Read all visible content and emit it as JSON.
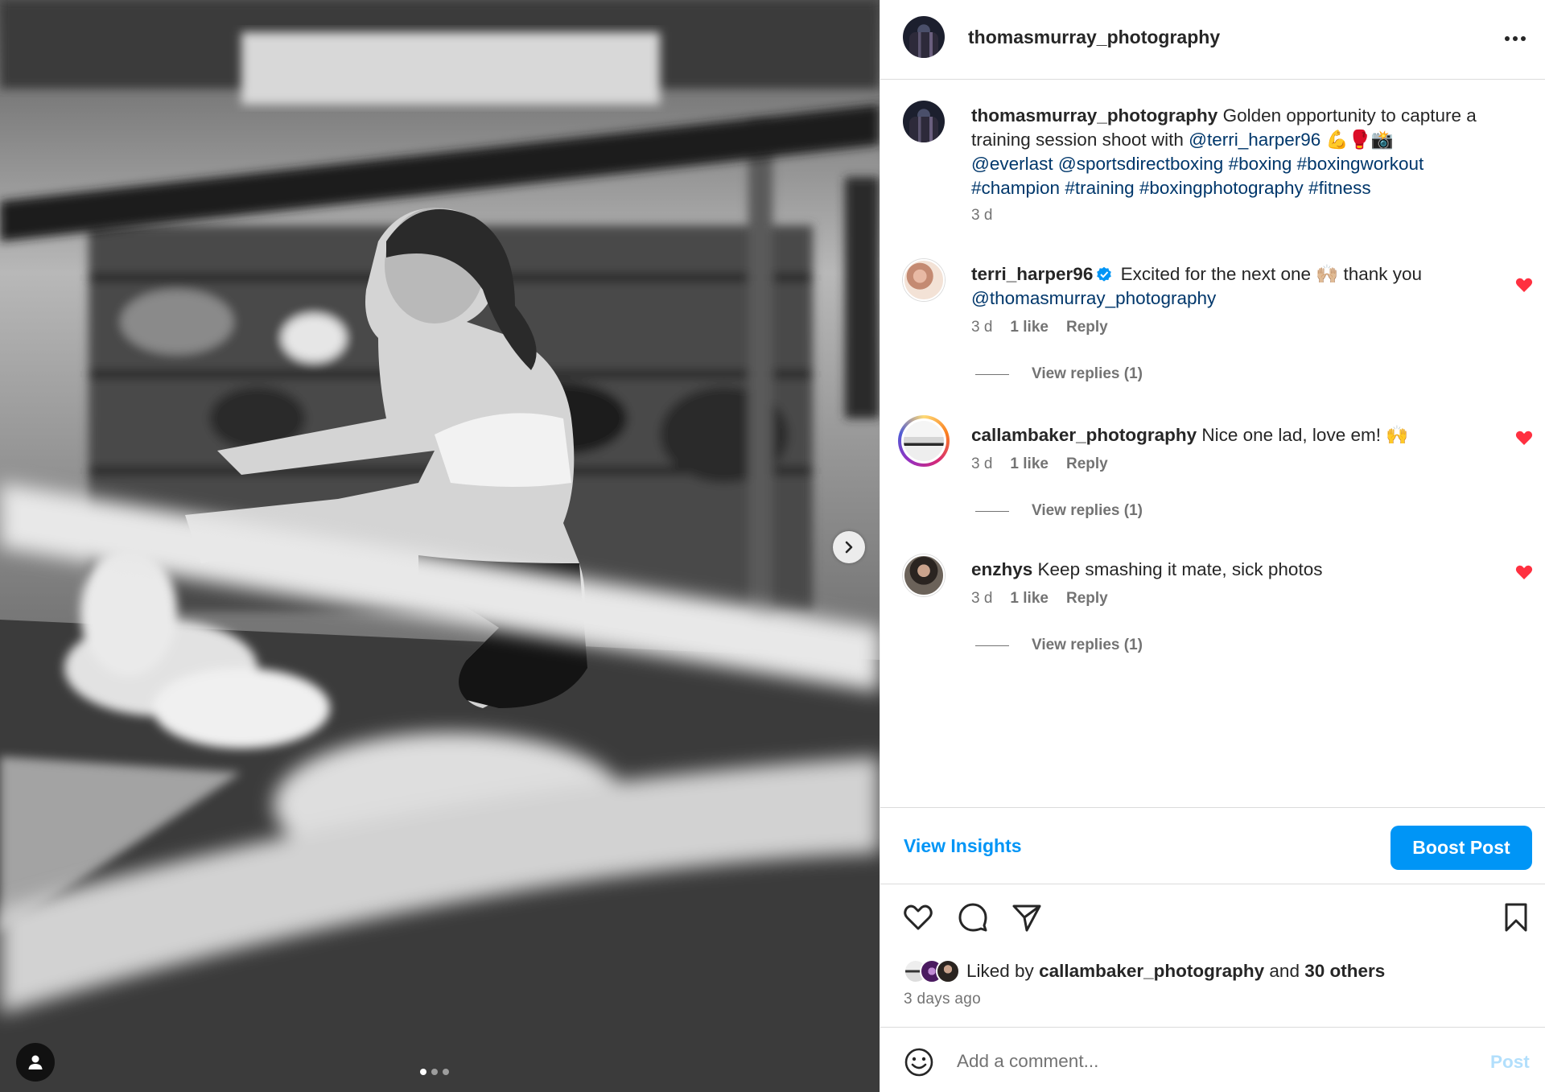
{
  "post": {
    "author": "thomasmurray_photography",
    "caption": {
      "username": "thomasmurray_photography",
      "text_1": " Golden opportunity to capture a training session shoot with ",
      "mention_1": "@terri_harper96",
      "emojis": " 💪🥊📸",
      "mention_2": "@everlast",
      "mention_3": "@sportsdirectboxing",
      "hashtags_1": "#boxing #boxingworkout",
      "hashtags_2": "#champion #training #boxingphotography #fitness",
      "time": "3 d"
    },
    "carousel": {
      "slides": 3,
      "active": 1
    }
  },
  "comments": [
    {
      "username": "terri_harper96",
      "verified": true,
      "text": " Excited for the next one 🙌🏼 thank you ",
      "mention": "@thomasmurray_photography",
      "time": "3 d",
      "likes": "1 like",
      "reply": "Reply",
      "view_replies": "View replies (1)"
    },
    {
      "username": "callambaker_photography",
      "text": " Nice one lad, love em! 🙌",
      "time": "3 d",
      "likes": "1 like",
      "reply": "Reply",
      "view_replies": "View replies (1)"
    },
    {
      "username": "enzhys",
      "text": " Keep smashing it mate, sick photos",
      "time": "3 d",
      "likes": "1 like",
      "reply": "Reply",
      "view_replies": "View replies (1)"
    }
  ],
  "insights": {
    "view_insights": "View Insights",
    "boost_post": "Boost Post"
  },
  "likes": {
    "prefix": "Liked by ",
    "user": "callambaker_photography",
    "middle": " and ",
    "others": "30 others",
    "time_ago": "3 days ago"
  },
  "add_comment": {
    "placeholder": "Add a comment...",
    "post_label": "Post"
  },
  "colors": {
    "accent": "#0095f6",
    "link": "#00376b",
    "heart": "#ff3040"
  },
  "icons": [
    "more-icon",
    "heart-icon",
    "comment-icon",
    "share-icon",
    "bookmark-icon",
    "emoji-icon",
    "chevron-right-icon",
    "user-tag-icon",
    "verified-icon"
  ]
}
